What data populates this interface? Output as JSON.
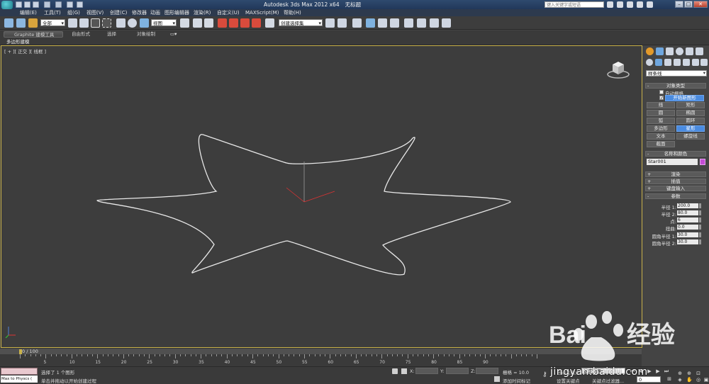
{
  "title_bar": {
    "app_name": "Autodesk 3ds Max  2012 x64",
    "doc_title": "无标题",
    "search_placeholder": "键入关键字或短语"
  },
  "menu": {
    "items": [
      "编辑(E)",
      "工具(T)",
      "组(G)",
      "视图(V)",
      "创建(C)",
      "修改器",
      "动画",
      "图形编辑器",
      "渲染(R)",
      "自定义(U)",
      "MAXScript(M)",
      "帮助(H)"
    ]
  },
  "toolbar": {
    "selection_filter": "全部",
    "ref_coord": "视图",
    "named_selection": "创建选择集"
  },
  "ribbon": {
    "tabs": [
      "Graphite 建模工具",
      "自由形式",
      "选择",
      "对象绘制"
    ],
    "panel_label": "多边形建模"
  },
  "viewport": {
    "label": "[ + ][ 正交 ][ 线框 ]"
  },
  "command_panel": {
    "category_dropdown": "样条线",
    "object_type": {
      "header": "对象类型",
      "auto_grid": "自动栅格",
      "start_new_shape": "开始新图形",
      "buttons": [
        "线",
        "矩形",
        "圆",
        "椭圆",
        "弧",
        "圆环",
        "多边形",
        "星形",
        "文本",
        "螺旋线",
        "截面"
      ],
      "active_button": "星形"
    },
    "name_color": {
      "header": "名称和颜色",
      "name": "Star001",
      "color": "#c44dd6"
    },
    "rollouts": [
      "渲染",
      "插值",
      "键盘输入"
    ],
    "parameters": {
      "header": "参数",
      "rows": [
        {
          "label": "半径 1:",
          "value": "200.0"
        },
        {
          "label": "半径 2:",
          "value": "80.0"
        },
        {
          "label": "点:",
          "value": "6"
        },
        {
          "label": "扭曲:",
          "value": "0.0"
        },
        {
          "label": "圆角半径 1:",
          "value": "30.0"
        },
        {
          "label": "圆角半径 2:",
          "value": "30.0"
        }
      ]
    }
  },
  "timeline": {
    "frame_label": "0 / 100",
    "ticks": [
      "5",
      "10",
      "15",
      "20",
      "25",
      "30",
      "35",
      "40",
      "45",
      "50",
      "55",
      "60",
      "65",
      "70",
      "75",
      "80",
      "85",
      "90"
    ]
  },
  "status_bar": {
    "maxscript": "Max to Physcs (",
    "status_line": "选择了 1 个图形",
    "prompt_line": "单击并拖动以开始创建过程",
    "x_label": "X:",
    "y_label": "Y:",
    "z_label": "Z:",
    "grid": "栅格 = 10.0",
    "add_time_tag": "添加时间标记",
    "auto_key": "自动关键点",
    "set_key": "设置关键点",
    "selected_combo": "选定对象",
    "key_filters": "关键点过滤器...",
    "frame_value": "0"
  },
  "watermark": {
    "text": "jingyan.baidu.com"
  }
}
